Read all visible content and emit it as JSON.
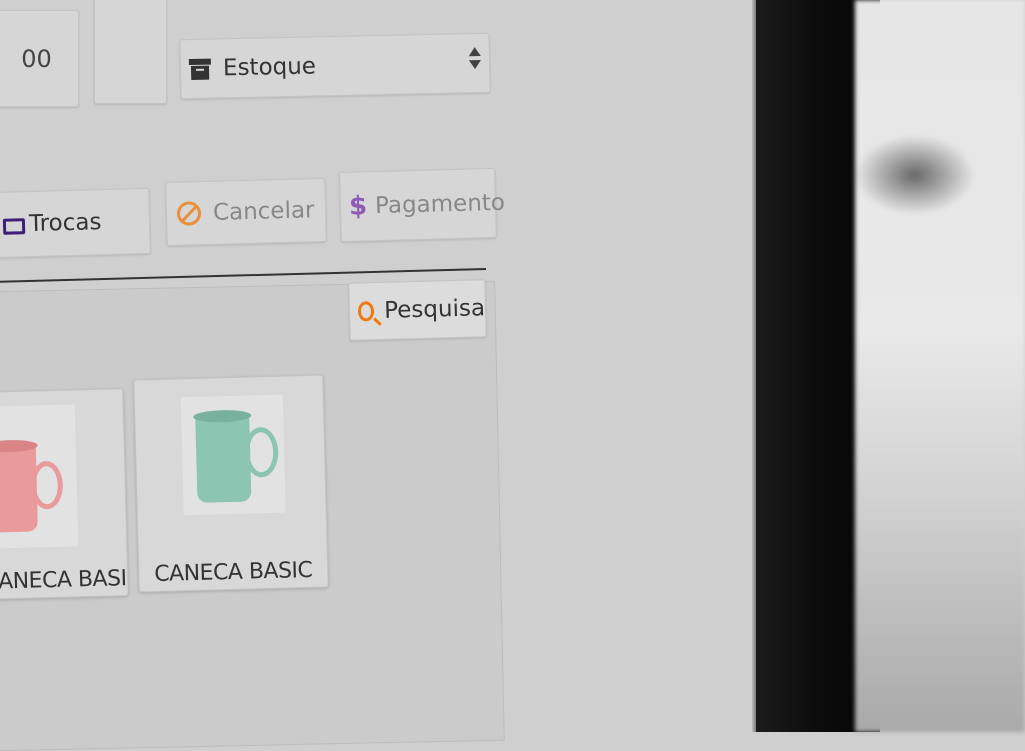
{
  "fields": {
    "time_value": "00"
  },
  "stock_select": {
    "value": "Estoque",
    "icon": "archive-box-icon"
  },
  "actions": {
    "trocas_label": "Trocas",
    "cancelar_label": "Cancelar",
    "pagamento_label": "Pagamento"
  },
  "search": {
    "label": "Pesquisa"
  },
  "products": [
    {
      "name": "CANECA BASIC",
      "mug_color": "#e99a9a"
    },
    {
      "name": "CANECA BASIC",
      "mug_color": "#8cc5b2"
    }
  ],
  "colors": {
    "cancel_icon": "#e8913a",
    "payment_icon": "#8e5bb5",
    "search_icon": "#ee7a10",
    "exchange_icon": "#3d1f7a"
  }
}
